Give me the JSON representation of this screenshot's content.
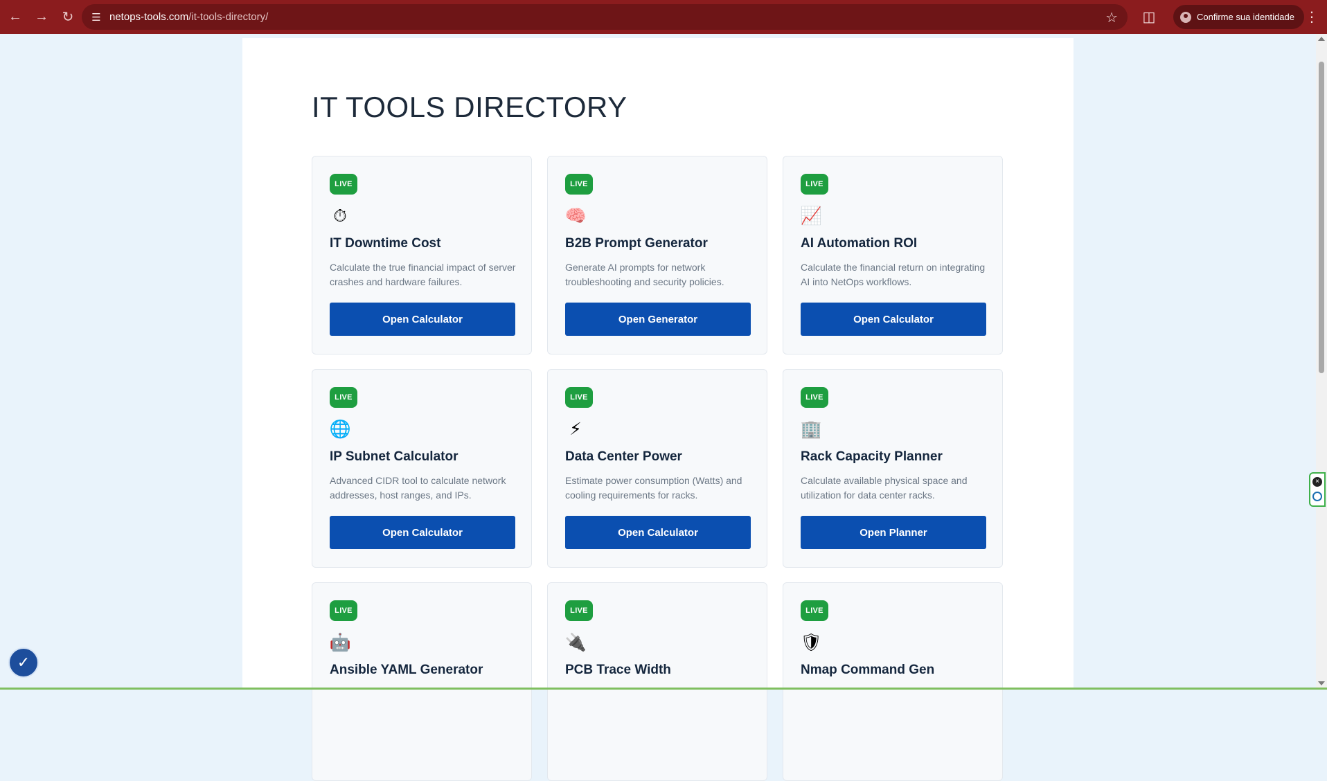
{
  "browser": {
    "url_domain": "netops-tools.com",
    "url_path": "/it-tools-directory/",
    "identity_label": "Confirme sua identidade"
  },
  "page": {
    "title": "IT TOOLS DIRECTORY"
  },
  "cards": [
    {
      "badge": "LIVE",
      "icon": "⏱",
      "title": "IT Downtime Cost",
      "desc": "Calculate the true financial impact of server crashes and hardware failures.",
      "button": "Open Calculator"
    },
    {
      "badge": "LIVE",
      "icon": "🧠",
      "title": "B2B Prompt Generator",
      "desc": "Generate AI prompts for network troubleshooting and security policies.",
      "button": "Open Generator"
    },
    {
      "badge": "LIVE",
      "icon": "📈",
      "title": "AI Automation ROI",
      "desc": "Calculate the financial return on integrating AI into NetOps workflows.",
      "button": "Open Calculator"
    },
    {
      "badge": "LIVE",
      "icon": "🌐",
      "title": "IP Subnet Calculator",
      "desc": "Advanced CIDR tool to calculate network addresses, host ranges, and IPs.",
      "button": "Open Calculator"
    },
    {
      "badge": "LIVE",
      "icon": "⚡",
      "title": "Data Center Power",
      "desc": "Estimate power consumption (Watts) and cooling requirements for racks.",
      "button": "Open Calculator"
    },
    {
      "badge": "LIVE",
      "icon": "🏢",
      "title": "Rack Capacity Planner",
      "desc": "Calculate available physical space and utilization for data center racks.",
      "button": "Open Planner"
    },
    {
      "badge": "LIVE",
      "icon": "🤖",
      "title": "Ansible YAML Generator",
      "desc": "",
      "button": ""
    },
    {
      "badge": "LIVE",
      "icon": "🔌",
      "title": "PCB Trace Width",
      "desc": "",
      "button": ""
    },
    {
      "badge": "LIVE",
      "icon": "🛡",
      "title": "Nmap Command Gen",
      "desc": "",
      "button": ""
    }
  ],
  "colors": {
    "chrome": "#8b1c1e",
    "badge": "#1e9e40",
    "button": "#0b4fb0",
    "page_bg": "#e9f3fb"
  }
}
